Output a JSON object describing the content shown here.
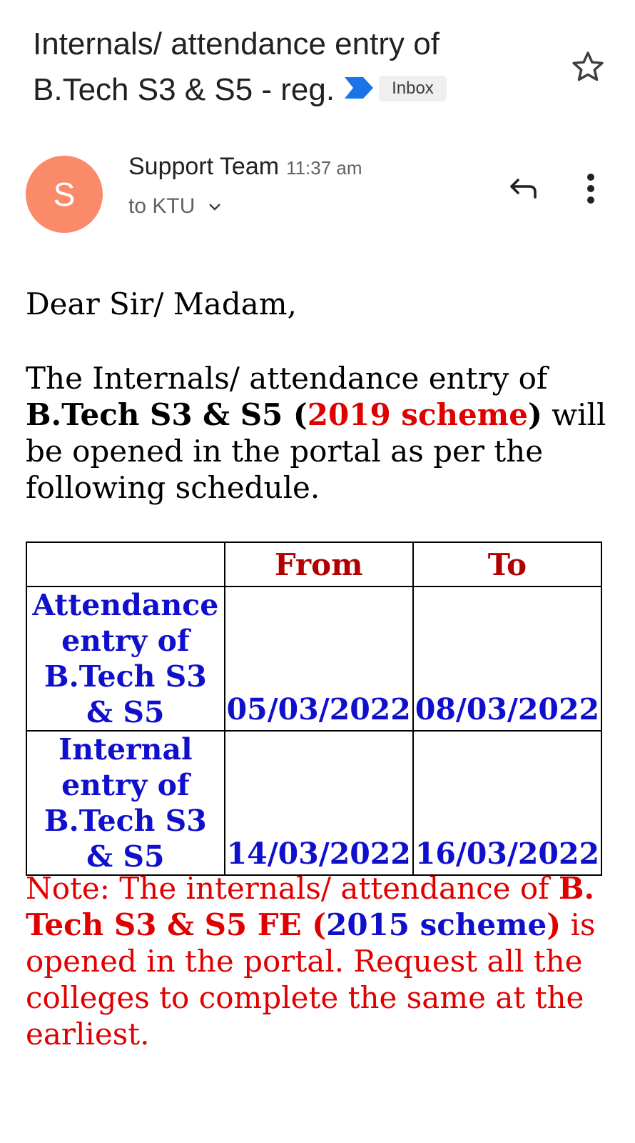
{
  "subject": {
    "line1": "Internals/ attendance entry of",
    "line2": "B.Tech S3 & S5 - reg.",
    "label_badge": "Inbox"
  },
  "sender": {
    "avatar_letter": "S",
    "name": "Support Team",
    "time": "11:37 am",
    "to": "to KTU"
  },
  "message": {
    "greeting": "Dear Sir/ Madam,",
    "intro_1": "The Internals/ attendance entry of",
    "intro_bold_1": "B.Tech S3 & S5 (",
    "intro_scheme": "2019 scheme",
    "intro_bold_2": ")",
    "intro_2": " will be opened in the portal as per the following schedule."
  },
  "schedule": {
    "headers": [
      "",
      "From",
      "To"
    ],
    "rows": [
      {
        "label": "Attendance entry of B.Tech S3 & S5",
        "from": "05/03/2022",
        "to": "08/03/2022"
      },
      {
        "label": "Internal entry of B.Tech S3 & S5",
        "from": "14/03/2022",
        "to": "16/03/2022"
      }
    ]
  },
  "note": {
    "part1": "Note: The internals/ attendance of ",
    "part2_bold": "B. Tech S3 & S5 FE (",
    "part3_blue": "2015 scheme",
    "part4_bold": ")",
    "part5": " is opened in the portal. Request all the colleges to complete the same at the earliest."
  },
  "icons": {
    "importance": "importance-marker-icon",
    "star": "star-icon",
    "reply": "reply-icon",
    "more": "more-vert-icon",
    "chevron": "chevron-down-icon"
  },
  "colors": {
    "importance_marker": "#1a73e8",
    "avatar": "#fa8a69",
    "scheme_red": "#e00000",
    "table_blue": "#1010cc",
    "header_red": "#b00000"
  }
}
